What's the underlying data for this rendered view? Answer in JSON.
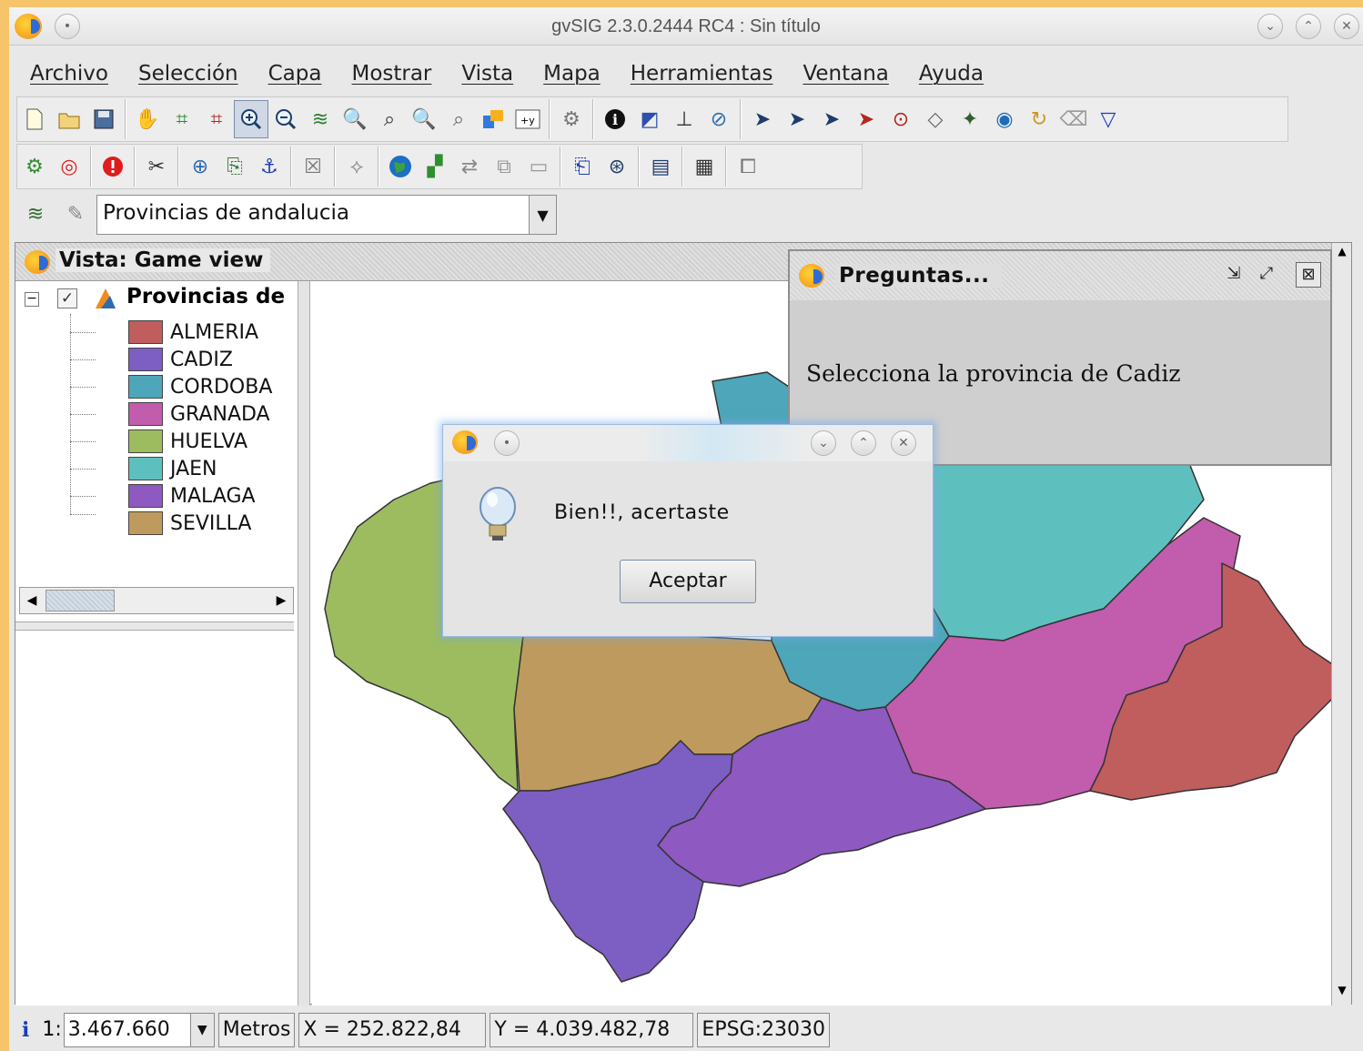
{
  "window": {
    "title": "gvSIG 2.3.0.2444 RC4 : Sin título"
  },
  "menu": [
    "Archivo",
    "Selección",
    "Capa",
    "Mostrar",
    "Vista",
    "Mapa",
    "Herramientas",
    "Ventana",
    "Ayuda"
  ],
  "toolbar1_icons": [
    "new-file-icon",
    "open-file-icon",
    "save-icon",
    "pan-hand-icon",
    "zoom-extent-icon",
    "zoom-full-icon",
    "zoom-in-icon",
    "zoom-out-icon",
    "layers-icon",
    "zoom-select-icon",
    "zoom-rect-icon",
    "zoom-prev-icon",
    "zoom-next-icon",
    "locator-icon",
    "coordinates-icon",
    "gear-icon",
    "info-icon",
    "measure-area-icon",
    "measure-distance-icon",
    "hyperlink-icon",
    "select-pointer-icon",
    "select-rect-icon",
    "select-poly-icon",
    "select-circle-icon",
    "select-area-icon",
    "buffer-icon",
    "geoprocess-icon",
    "globe-icon",
    "refresh-icon",
    "clean-icon",
    "filter-icon"
  ],
  "toolbar2_icons": [
    "settings-icon",
    "target-icon",
    "warning-icon",
    "tools-icon",
    "add-layer-icon",
    "export-icon",
    "pin-icon",
    "edit-icon",
    "vertex-icon",
    "globe-3d-icon",
    "map-icon",
    "sync-icon",
    "layout-icon",
    "image-icon",
    "document-search-icon",
    "binoculars-icon",
    "table-icon",
    "table-edit-icon",
    "copy-icon"
  ],
  "layer_combo": {
    "value": "Provincias de andalucia"
  },
  "view": {
    "title": "Vista: Game view",
    "layer_name": "Provincias de",
    "legend": [
      {
        "label": "ALMERIA",
        "color": "#c05d5d"
      },
      {
        "label": "CADIZ",
        "color": "#7d5ec2"
      },
      {
        "label": "CORDOBA",
        "color": "#4da6b9"
      },
      {
        "label": "GRANADA",
        "color": "#c25cad"
      },
      {
        "label": "HUELVA",
        "color": "#9dbc5f"
      },
      {
        "label": "JAEN",
        "color": "#5ec0be"
      },
      {
        "label": "MALAGA",
        "color": "#8e59c0"
      },
      {
        "label": "SEVILLA",
        "color": "#bf9a5e"
      }
    ]
  },
  "preguntas": {
    "title": "Preguntas...",
    "question": "Selecciona la provincia de Cadiz"
  },
  "dialog": {
    "message": "Bien!!, acertaste",
    "button": "Aceptar"
  },
  "status": {
    "info": "i",
    "scale_prefix": "1:",
    "scale": "3.467.660",
    "units": "Metros",
    "x": "X = 252.822,84",
    "y": "Y = 4.039.482,78",
    "epsg": "EPSG:23030"
  }
}
